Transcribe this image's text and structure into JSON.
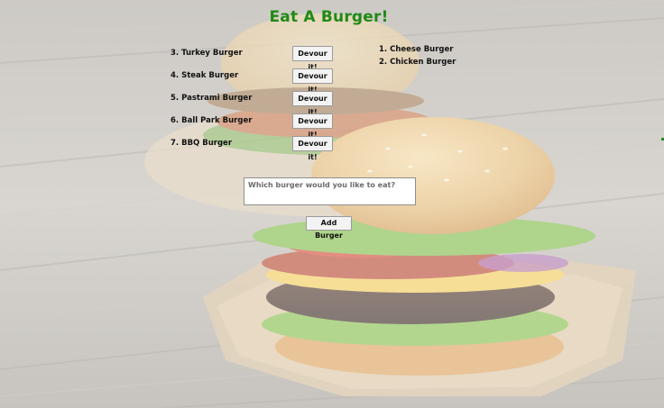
{
  "page": {
    "title": "Eat A Burger!"
  },
  "uneaten_burgers": [
    {
      "label": "3. Turkey Burger",
      "button": "Devour it!"
    },
    {
      "label": "4. Steak Burger",
      "button": "Devour it!"
    },
    {
      "label": "5. Pastrami Burger",
      "button": "Devour it!"
    },
    {
      "label": "6. Ball Park Burger",
      "button": "Devour it!"
    },
    {
      "label": "7. BBQ Burger",
      "button": "Devour it!"
    }
  ],
  "devoured_burgers": [
    {
      "label": "1. Cheese Burger"
    },
    {
      "label": "2. Chicken Burger"
    }
  ],
  "form": {
    "placeholder": "Which burger would you like to eat?",
    "value": "",
    "submit_label": "Add Burger"
  },
  "background": {
    "description_icon": "burger-photo-background",
    "colors": {
      "wood": "#c9c3bb",
      "title": "#1f8a16"
    }
  }
}
